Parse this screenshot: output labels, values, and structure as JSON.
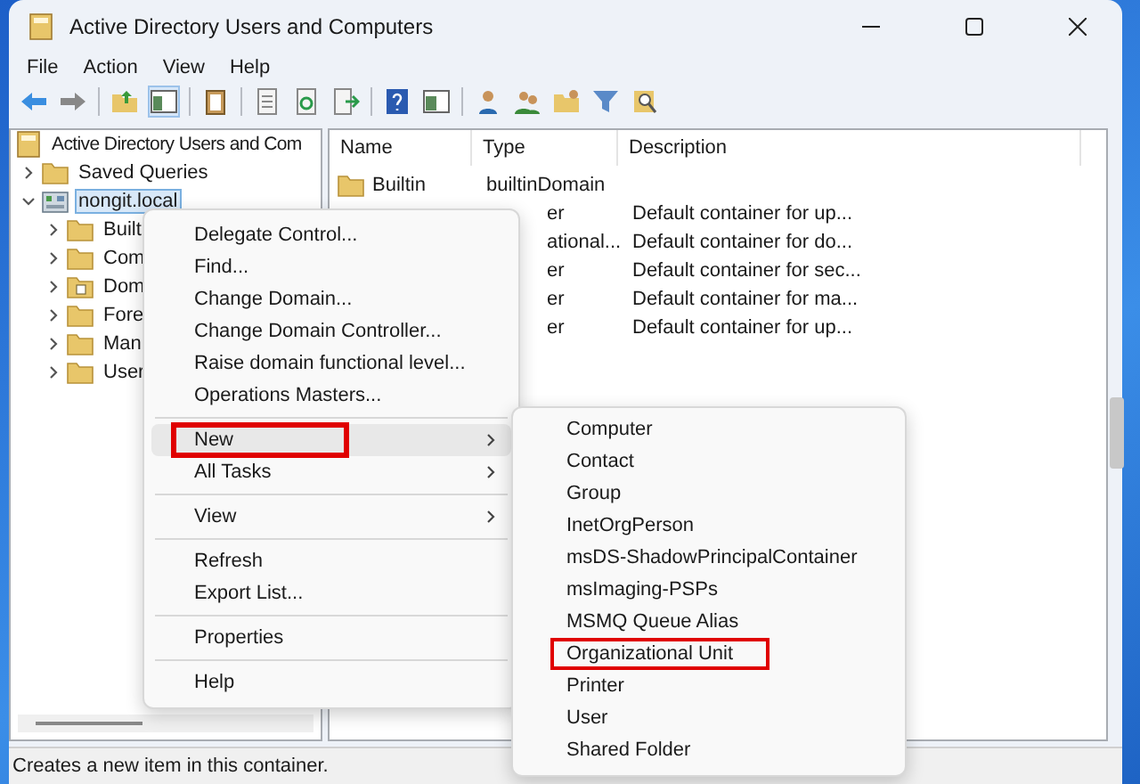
{
  "window": {
    "title": "Active Directory Users and Computers"
  },
  "menu_bar": [
    "File",
    "Action",
    "View",
    "Help"
  ],
  "tree": {
    "root": "Active Directory Users and Com",
    "items": [
      {
        "label": "Saved Queries",
        "kind": "folder",
        "expanded": false,
        "selected": false
      },
      {
        "label": "nongit.local",
        "kind": "domain",
        "expanded": true,
        "selected": true,
        "children": [
          {
            "label": "Built",
            "kind": "folder",
            "expanded": false,
            "selected": false
          },
          {
            "label": "Com",
            "kind": "folder",
            "expanded": false,
            "selected": false
          },
          {
            "label": "Dom",
            "kind": "ou",
            "expanded": false,
            "selected": false
          },
          {
            "label": "Fore",
            "kind": "folder",
            "expanded": false,
            "selected": false
          },
          {
            "label": "Man",
            "kind": "folder",
            "expanded": false,
            "selected": false
          },
          {
            "label": "User",
            "kind": "folder",
            "expanded": false,
            "selected": false
          }
        ]
      }
    ]
  },
  "list": {
    "columns": [
      "Name",
      "Type",
      "Description"
    ],
    "rows": [
      {
        "name": "Builtin",
        "type": "builtinDomain"
      },
      {
        "type": "er",
        "description": "Default container for up..."
      },
      {
        "type": "ational...",
        "description": "Default container for do..."
      },
      {
        "type": "er",
        "description": "Default container for sec..."
      },
      {
        "type": "er",
        "description": "Default container for ma..."
      },
      {
        "type": "er",
        "description": "Default container for up..."
      }
    ]
  },
  "context_menu": {
    "items": [
      {
        "kind": "item",
        "label": "Delegate Control...",
        "has_submenu": false,
        "selected": false,
        "annotated": false
      },
      {
        "kind": "item",
        "label": "Find...",
        "has_submenu": false,
        "selected": false,
        "annotated": false
      },
      {
        "kind": "item",
        "label": "Change Domain...",
        "has_submenu": false,
        "selected": false,
        "annotated": false
      },
      {
        "kind": "item",
        "label": "Change Domain Controller...",
        "has_submenu": false,
        "selected": false,
        "annotated": false
      },
      {
        "kind": "item",
        "label": "Raise domain functional level...",
        "has_submenu": false,
        "selected": false,
        "annotated": false
      },
      {
        "kind": "item",
        "label": "Operations Masters...",
        "has_submenu": false,
        "selected": false,
        "annotated": false
      },
      {
        "kind": "separator"
      },
      {
        "kind": "item",
        "label": "New",
        "has_submenu": true,
        "selected": true,
        "annotated": true
      },
      {
        "kind": "item",
        "label": "All Tasks",
        "has_submenu": true,
        "selected": false,
        "annotated": false
      },
      {
        "kind": "separator"
      },
      {
        "kind": "item",
        "label": "View",
        "has_submenu": true,
        "selected": false,
        "annotated": false
      },
      {
        "kind": "separator"
      },
      {
        "kind": "item",
        "label": "Refresh",
        "has_submenu": false,
        "selected": false,
        "annotated": false
      },
      {
        "kind": "item",
        "label": "Export List...",
        "has_submenu": false,
        "selected": false,
        "annotated": false
      },
      {
        "kind": "separator"
      },
      {
        "kind": "item",
        "label": "Properties",
        "has_submenu": false,
        "selected": false,
        "annotated": false
      },
      {
        "kind": "separator"
      },
      {
        "kind": "item",
        "label": "Help",
        "has_submenu": false,
        "selected": false,
        "annotated": false
      }
    ]
  },
  "submenu": {
    "items": [
      {
        "label": "Computer",
        "annotated": false
      },
      {
        "label": "Contact",
        "annotated": false
      },
      {
        "label": "Group",
        "annotated": false
      },
      {
        "label": "InetOrgPerson",
        "annotated": false
      },
      {
        "label": "msDS-ShadowPrincipalContainer",
        "annotated": false
      },
      {
        "label": "msImaging-PSPs",
        "annotated": false
      },
      {
        "label": "MSMQ Queue Alias",
        "annotated": false
      },
      {
        "label": "Organizational Unit",
        "annotated": true
      },
      {
        "label": "Printer",
        "annotated": false
      },
      {
        "label": "User",
        "annotated": false
      },
      {
        "label": "Shared Folder",
        "annotated": false
      }
    ]
  },
  "status_bar": "Creates a new item in this container."
}
